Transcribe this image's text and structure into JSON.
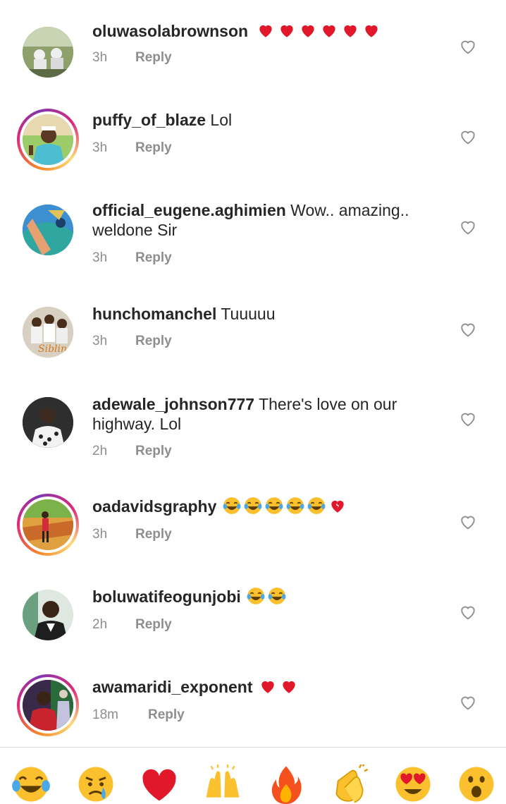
{
  "comments": [
    {
      "username": "oluwasolabrownson",
      "text": "",
      "emojis": [
        "heart",
        "heart",
        "heart",
        "heart",
        "heart",
        "heart"
      ],
      "time": "3h",
      "reply_label": "Reply",
      "story_ring": false,
      "avatar_color": "#6b7d5a"
    },
    {
      "username": "puffy_of_blaze",
      "text": " Lol",
      "emojis": [],
      "time": "3h",
      "reply_label": "Reply",
      "story_ring": true,
      "avatar_color": "#4bbfd1"
    },
    {
      "username": "official_eugene.aghimien",
      "text": " Wow.. amazing..",
      "text2": "weldone Sir",
      "emojis": [],
      "time": "3h",
      "reply_label": "Reply",
      "story_ring": false,
      "avatar_color": "#2a6fb0"
    },
    {
      "username": "hunchomanchel",
      "text": " Tuuuuu",
      "emojis": [],
      "time": "3h",
      "reply_label": "Reply",
      "story_ring": false,
      "avatar_color": "#c9a87a"
    },
    {
      "username": "adewale_johnson777",
      "text": " There's love on our",
      "text2": "highway. Lol",
      "emojis": [],
      "time": "2h",
      "reply_label": "Reply",
      "story_ring": false,
      "avatar_color": "#2b2b2b"
    },
    {
      "username": "oadavidsgraphy",
      "text": " ",
      "emojis": [
        "laugh",
        "laugh",
        "laugh",
        "laugh",
        "laugh",
        "broken-heart"
      ],
      "time": "3h",
      "reply_label": "Reply",
      "story_ring": true,
      "avatar_color": "#d8892c"
    },
    {
      "username": "boluwatifeogunjobi",
      "text": " ",
      "emojis": [
        "laugh",
        "laugh"
      ],
      "time": "2h",
      "reply_label": "Reply",
      "story_ring": false,
      "avatar_color": "#e8e8e8"
    },
    {
      "username": "awamaridi_exponent",
      "text": " ",
      "emojis": [
        "heart",
        "heart"
      ],
      "time": "18m",
      "reply_label": "Reply",
      "story_ring": true,
      "avatar_color": "#8a2a2a"
    }
  ],
  "emoji_bar": [
    "laugh-cry",
    "crying",
    "red-heart",
    "raised-hands",
    "fire",
    "clapping-hands",
    "heart-eyes",
    "surprised"
  ],
  "colors": {
    "heart": "#e0182a",
    "text": "#262626",
    "secondary": "#8e8e8e",
    "emoji_yellow": "#fbc02d"
  }
}
